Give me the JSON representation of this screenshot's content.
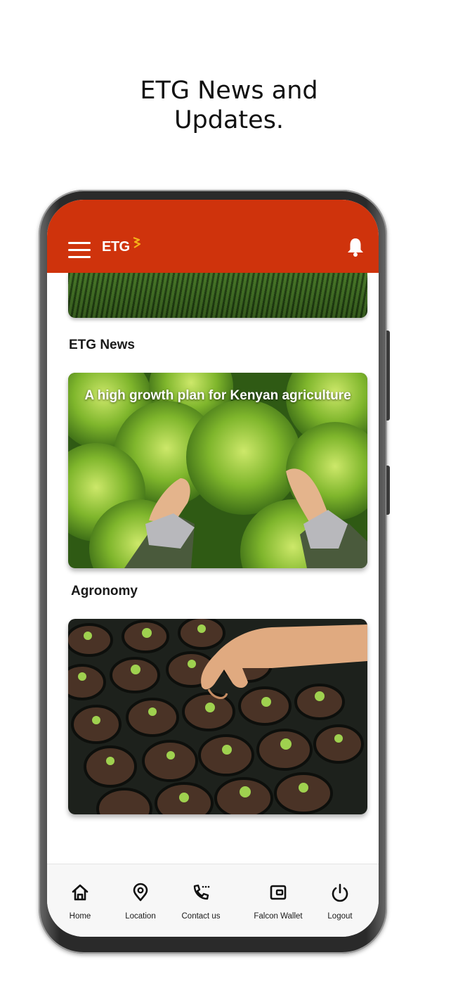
{
  "headline": {
    "line1": "ETG News and",
    "line2": "Updates."
  },
  "appbar": {
    "logo_text": "ETG",
    "brand_color": "#cf330c",
    "menu_icon": "hamburger-icon",
    "notification_icon": "bell-icon"
  },
  "sections": [
    {
      "title": "ETG News",
      "card_caption": "A high growth plan for Kenyan agriculture"
    },
    {
      "title": "Agronomy",
      "card_caption": ""
    }
  ],
  "bottom_nav": {
    "items": [
      {
        "label": "Home",
        "icon": "home-icon"
      },
      {
        "label": "Location",
        "icon": "location-pin-icon"
      },
      {
        "label": "Contact us",
        "icon": "phone-icon"
      },
      {
        "label": "Falcon Wallet",
        "icon": "wallet-icon"
      },
      {
        "label": "Logout",
        "icon": "power-icon"
      }
    ]
  }
}
